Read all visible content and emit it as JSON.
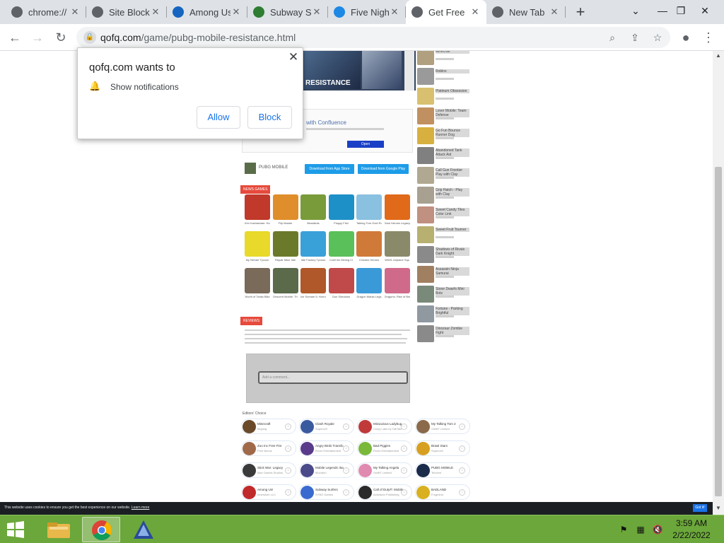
{
  "tabs": [
    {
      "label": "chrome://",
      "favicon": "chrome-globe-icon",
      "color": "#5f6368"
    },
    {
      "label": "Site Block",
      "favicon": "globe-icon",
      "color": "#5f6368"
    },
    {
      "label": "Among Us",
      "favicon": "box-icon",
      "color": "#1565c0"
    },
    {
      "label": "Subway Su",
      "favicon": "gamepad-icon",
      "color": "#2e7d32"
    },
    {
      "label": "Five Nigh",
      "favicon": "face-icon",
      "color": "#1e88e5"
    },
    {
      "label": "Get Free",
      "favicon": "globe-icon",
      "color": "#5f6368",
      "active": true
    },
    {
      "label": "New Tab",
      "favicon": "chrome-icon",
      "color": "#5f6368"
    }
  ],
  "tab_close_glyph": "✕",
  "new_tab_glyph": "+",
  "window_controls": {
    "dropdown": "⌄",
    "minimize": "—",
    "restore": "❐",
    "close": "✕"
  },
  "toolbar": {
    "back": "←",
    "forward": "→",
    "reload": "↻",
    "url_host": "qofq.com",
    "url_path": "/game/pubg-mobile-resistance.html",
    "lock_glyph": "🔒",
    "zoom": "⌕",
    "share": "⇪",
    "star": "☆",
    "profile": "●",
    "menu": "⋮"
  },
  "page": {
    "game_banner_text": "RESISTANCE",
    "ad_title": "with Confluence",
    "ad_button": "Open",
    "pubg_name": "PUBG MOBILE",
    "appstore_btn": "Download from App Store",
    "googleplay_btn": "Download from Google Play",
    "news_games_tag": "NEWS GAMES",
    "reviews_tag": "REVIEWS",
    "editors_choice": "Editors' Choice",
    "comment_placeholder": "Add a comment..."
  },
  "games": [
    {
      "label": "Kim Kardashian: Holl",
      "color": "#c0392b"
    },
    {
      "label": "Flip Master",
      "color": "#e08e2b"
    },
    {
      "label": "Beastkids",
      "color": "#7a9b3a"
    },
    {
      "label": "Flappy Fish",
      "color": "#1e90c8"
    },
    {
      "label": "Talking Tom Gold Ru",
      "color": "#8ac0e0"
    },
    {
      "label": "Dark Heroes Legacy",
      "color": "#e06a1a"
    },
    {
      "label": "My Nerwie Tycoon",
      "color": "#e8d92a"
    },
    {
      "label": "Repair Mine Idle",
      "color": "#6b7a2a"
    },
    {
      "label": "Idle Factory Tycoon",
      "color": "#3aa0d8"
    },
    {
      "label": "Craft Inc Mining Cl",
      "color": "#5ac05a"
    },
    {
      "label": "Chicken Heroes",
      "color": "#d07a3a"
    },
    {
      "label": "WWII: Airplane Sqs",
      "color": "#8a8a6a"
    },
    {
      "label": "World of Tanks Blitz",
      "color": "#7a6a5a"
    },
    {
      "label": "Descent Mobile: Th",
      "color": "#5a6a4a"
    },
    {
      "label": "Ice Scream 5: Horror",
      "color": "#b0582a"
    },
    {
      "label": "Gun Simulator",
      "color": "#c04a4a"
    },
    {
      "label": "Dragon Mania Legs",
      "color": "#3a9ad8"
    },
    {
      "label": "Dragons: Rise of Berk",
      "color": "#d06a8a"
    }
  ],
  "side_items": [
    {
      "title": "Minecraft",
      "color": "#b0a080"
    },
    {
      "title": "Roblox",
      "color": "#9a9a9a"
    },
    {
      "title": "Platinum Obsession",
      "color": "#d8c070"
    },
    {
      "title": "Lover Mobile: Team Defense",
      "color": "#c09060"
    },
    {
      "title": "Go Fun Bounce Runner Dog",
      "color": "#d8b040"
    },
    {
      "title": "Abandoned Tank Attack Aid",
      "color": "#808080"
    },
    {
      "title": "Call Gun Frontier Play with Clay",
      "color": "#b0a890"
    },
    {
      "title": "Grip Hatch - Play with Clay",
      "color": "#a8a090"
    },
    {
      "title": "Sweet Candy Tiles Color Link",
      "color": "#c09080"
    },
    {
      "title": "Sweet Fruit Tourner",
      "color": "#b8b070"
    },
    {
      "title": "Shadows of Rivals Dark Knight",
      "color": "#8a8a8a"
    },
    {
      "title": "Assassin Ninja Samurai",
      "color": "#a08060"
    },
    {
      "title": "Stone Dwarfs Mini Bots",
      "color": "#7a8a7a"
    },
    {
      "title": "Fortune - Parking Brightful",
      "color": "#9098a0"
    },
    {
      "title": "Dinozaur Zombie Fight",
      "color": "#8a8a8a"
    }
  ],
  "editors": [
    {
      "name": "Minecraft",
      "sub": "Mojang",
      "color": "#6b4a2a"
    },
    {
      "name": "Clash Royale",
      "sub": "Supercell",
      "color": "#3a5aa0"
    },
    {
      "name": "Miraculous Ladybug",
      "sub": "Crazy Labs by TabTale",
      "color": "#c03a3a"
    },
    {
      "name": "My Talking Tom 2",
      "sub": "Outfit7 Limited",
      "color": "#8a6a4a"
    },
    {
      "name": "Zoo Inc Free Fire",
      "sub": "Free Bonus",
      "color": "#a06a4a"
    },
    {
      "name": "Angry Birds Transfo",
      "sub": "Rovio Entertainment",
      "color": "#5a3a8a"
    },
    {
      "name": "Bad Piggies",
      "sub": "Rovio Entertainment",
      "color": "#7ab83a"
    },
    {
      "name": "Brawl Stars",
      "sub": "Supercell",
      "color": "#d8a020"
    },
    {
      "name": "Stick War: Legacy",
      "sub": "Max Games Studios",
      "color": "#3a3a3a"
    },
    {
      "name": "Mobile Legends: Ba",
      "sub": "Moonton",
      "color": "#4a4a8a"
    },
    {
      "name": "My Talking Angela",
      "sub": "Outfit7 Limited",
      "color": "#e08ab0"
    },
    {
      "name": "PUBG MOBILE",
      "sub": "Tencent",
      "color": "#1a2a4a"
    },
    {
      "name": "Among Us!",
      "sub": "Innersloth LLC",
      "color": "#c02a2a"
    },
    {
      "name": "Subway Surfers",
      "sub": "SYBO Games",
      "color": "#3a6ad0"
    },
    {
      "name": "Call of Duty®: Mobile",
      "sub": "Activision Publishing",
      "color": "#2a2a2a"
    },
    {
      "name": "BADLAND",
      "sub": "Frogmind",
      "color": "#d8b020"
    }
  ],
  "notification": {
    "title": "qofq.com wants to",
    "permission": "Show notifications",
    "allow": "Allow",
    "block": "Block",
    "close_glyph": "✕",
    "bell_glyph": "🔔"
  },
  "cookie": {
    "text": "This website uses cookies to ensure you get the best experience on our website.",
    "link": "Learn more",
    "button": "Got it!"
  },
  "taskbar": {
    "time": "3:59 AM",
    "date": "2/22/2022"
  },
  "colors": {
    "taskbar_green": "#6ba73a",
    "accent_blue": "#1a73e8",
    "tag_red": "#e64a3c"
  }
}
